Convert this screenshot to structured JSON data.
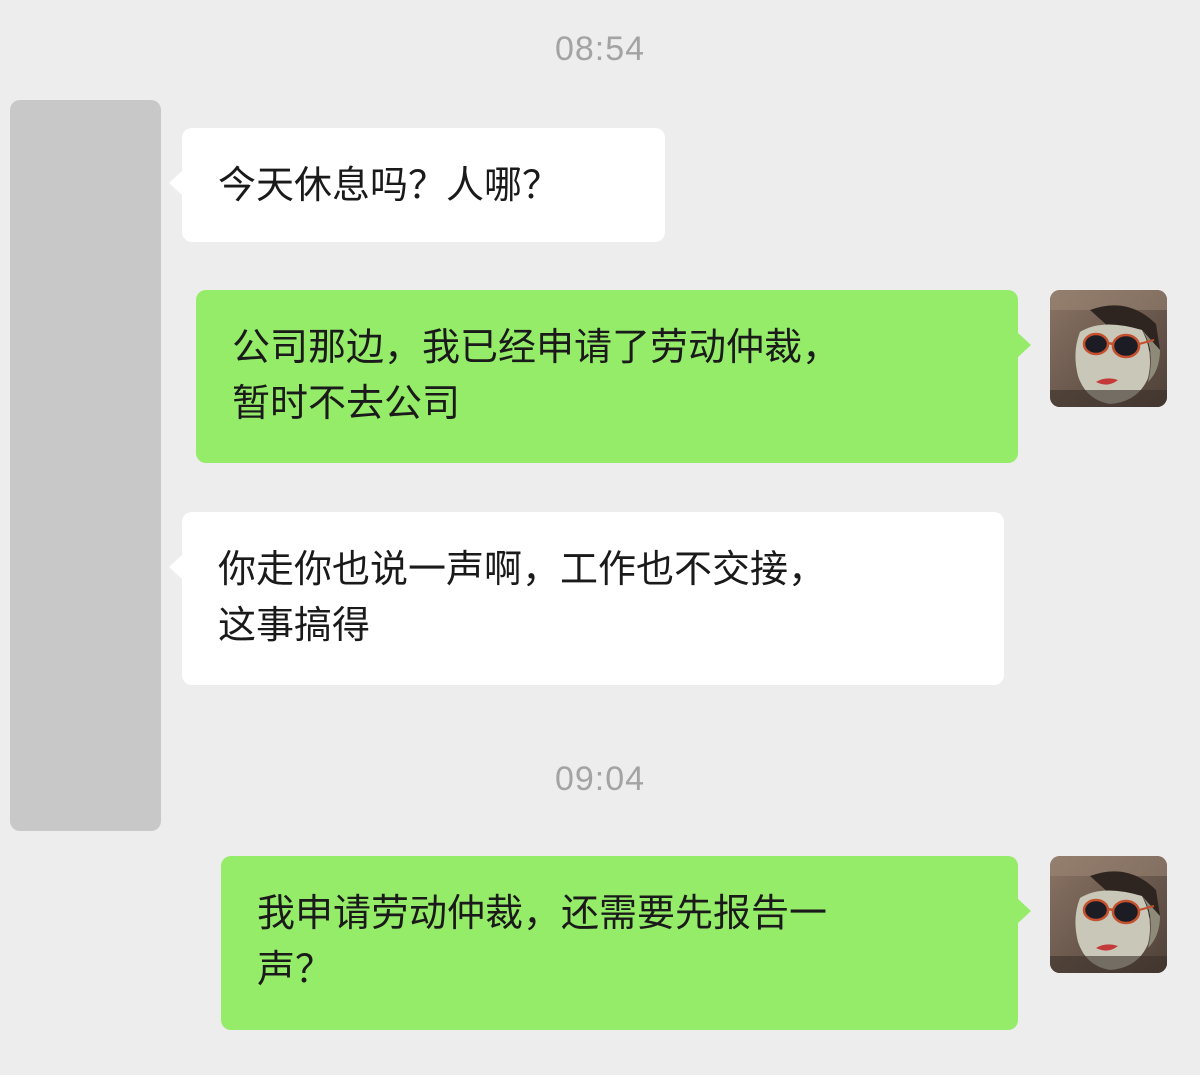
{
  "chat": {
    "timestamps": [
      "08:54",
      "09:04"
    ],
    "messages": [
      {
        "side": "in",
        "text": "今天休息吗？人哪？"
      },
      {
        "side": "out",
        "text": "公司那边，我已经申请了劳动仲裁，\n暂时不去公司"
      },
      {
        "side": "in",
        "text": "你走你也说一声啊，工作也不交接，\n这事搞得"
      },
      {
        "side": "out",
        "text": "我申请劳动仲裁，还需要先报告一\n声？"
      }
    ]
  },
  "colors": {
    "background": "#ededed",
    "incoming_bubble": "#ffffff",
    "outgoing_bubble": "#95ec69",
    "timestamp": "#a3a3a3",
    "redacted_avatar": "#c8c8c8"
  },
  "icons": {
    "left_avatar": "redacted-avatar",
    "right_avatar": "user-avatar-sunglasses"
  }
}
